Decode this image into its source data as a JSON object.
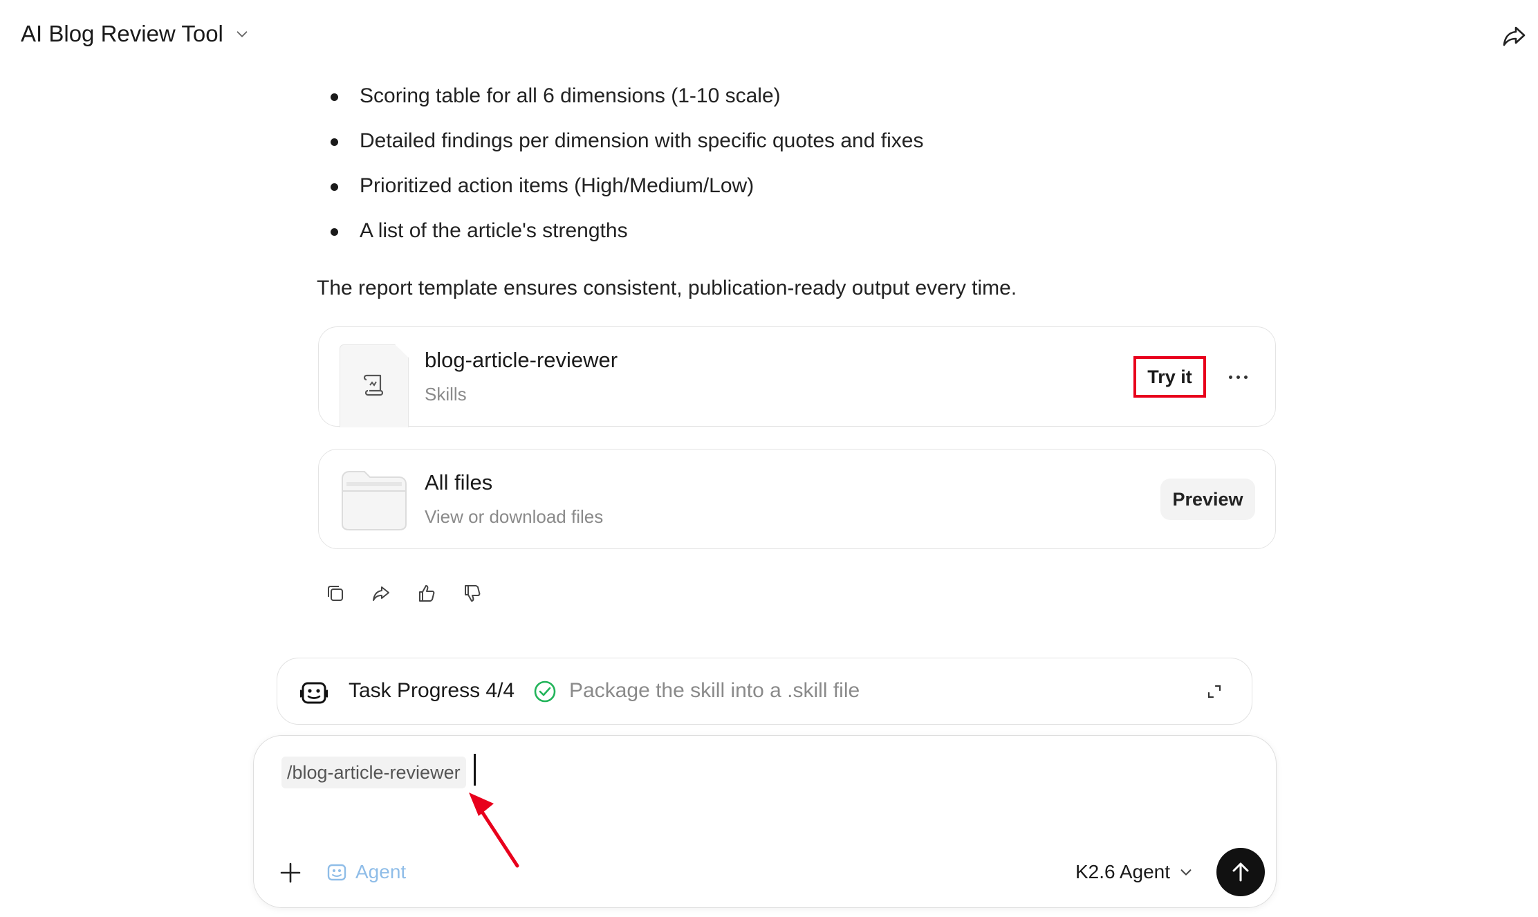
{
  "header": {
    "title": "AI Blog Review Tool",
    "dropdown_icon": "chevron-down-icon",
    "share_icon": "share-icon"
  },
  "message": {
    "bullets": [
      "Scoring table for all 6 dimensions (1-10 scale)",
      "Detailed findings per dimension with specific quotes and fixes",
      "Prioritized action items (High/Medium/Low)",
      "A list of the article's strengths"
    ],
    "summary": "The report template ensures consistent, publication-ready output every time."
  },
  "skill_card": {
    "title": "blog-article-reviewer",
    "subtitle": "Skills",
    "try_label": "Try it",
    "highlight_color": "#e8001c"
  },
  "files_card": {
    "title": "All files",
    "subtitle": "View or download files",
    "preview_label": "Preview"
  },
  "message_actions": [
    "copy-icon",
    "share-icon",
    "thumbs-up-icon",
    "thumbs-down-icon"
  ],
  "task_progress": {
    "label": "Task Progress 4/4",
    "step": "Package the skill into a .skill file",
    "check_color": "#22b45a"
  },
  "composer": {
    "command_chip": "/blog-article-reviewer",
    "agent_label": "Agent",
    "agent_color": "#8fbde8",
    "model_label": "K2.6 Agent",
    "annotation_arrow_color": "#e8001c"
  }
}
